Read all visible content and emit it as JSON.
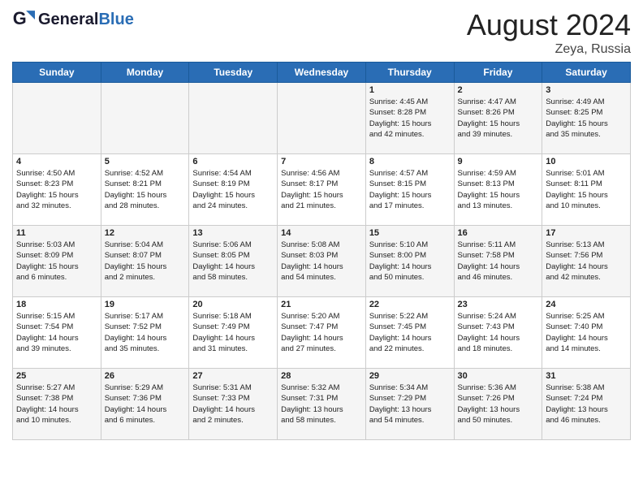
{
  "header": {
    "logo_line1": "General",
    "logo_line2": "Blue",
    "month": "August 2024",
    "location": "Zeya, Russia"
  },
  "days_of_week": [
    "Sunday",
    "Monday",
    "Tuesday",
    "Wednesday",
    "Thursday",
    "Friday",
    "Saturday"
  ],
  "weeks": [
    [
      {
        "day": "",
        "info": ""
      },
      {
        "day": "",
        "info": ""
      },
      {
        "day": "",
        "info": ""
      },
      {
        "day": "",
        "info": ""
      },
      {
        "day": "1",
        "info": "Sunrise: 4:45 AM\nSunset: 8:28 PM\nDaylight: 15 hours\nand 42 minutes."
      },
      {
        "day": "2",
        "info": "Sunrise: 4:47 AM\nSunset: 8:26 PM\nDaylight: 15 hours\nand 39 minutes."
      },
      {
        "day": "3",
        "info": "Sunrise: 4:49 AM\nSunset: 8:25 PM\nDaylight: 15 hours\nand 35 minutes."
      }
    ],
    [
      {
        "day": "4",
        "info": "Sunrise: 4:50 AM\nSunset: 8:23 PM\nDaylight: 15 hours\nand 32 minutes."
      },
      {
        "day": "5",
        "info": "Sunrise: 4:52 AM\nSunset: 8:21 PM\nDaylight: 15 hours\nand 28 minutes."
      },
      {
        "day": "6",
        "info": "Sunrise: 4:54 AM\nSunset: 8:19 PM\nDaylight: 15 hours\nand 24 minutes."
      },
      {
        "day": "7",
        "info": "Sunrise: 4:56 AM\nSunset: 8:17 PM\nDaylight: 15 hours\nand 21 minutes."
      },
      {
        "day": "8",
        "info": "Sunrise: 4:57 AM\nSunset: 8:15 PM\nDaylight: 15 hours\nand 17 minutes."
      },
      {
        "day": "9",
        "info": "Sunrise: 4:59 AM\nSunset: 8:13 PM\nDaylight: 15 hours\nand 13 minutes."
      },
      {
        "day": "10",
        "info": "Sunrise: 5:01 AM\nSunset: 8:11 PM\nDaylight: 15 hours\nand 10 minutes."
      }
    ],
    [
      {
        "day": "11",
        "info": "Sunrise: 5:03 AM\nSunset: 8:09 PM\nDaylight: 15 hours\nand 6 minutes."
      },
      {
        "day": "12",
        "info": "Sunrise: 5:04 AM\nSunset: 8:07 PM\nDaylight: 15 hours\nand 2 minutes."
      },
      {
        "day": "13",
        "info": "Sunrise: 5:06 AM\nSunset: 8:05 PM\nDaylight: 14 hours\nand 58 minutes."
      },
      {
        "day": "14",
        "info": "Sunrise: 5:08 AM\nSunset: 8:03 PM\nDaylight: 14 hours\nand 54 minutes."
      },
      {
        "day": "15",
        "info": "Sunrise: 5:10 AM\nSunset: 8:00 PM\nDaylight: 14 hours\nand 50 minutes."
      },
      {
        "day": "16",
        "info": "Sunrise: 5:11 AM\nSunset: 7:58 PM\nDaylight: 14 hours\nand 46 minutes."
      },
      {
        "day": "17",
        "info": "Sunrise: 5:13 AM\nSunset: 7:56 PM\nDaylight: 14 hours\nand 42 minutes."
      }
    ],
    [
      {
        "day": "18",
        "info": "Sunrise: 5:15 AM\nSunset: 7:54 PM\nDaylight: 14 hours\nand 39 minutes."
      },
      {
        "day": "19",
        "info": "Sunrise: 5:17 AM\nSunset: 7:52 PM\nDaylight: 14 hours\nand 35 minutes."
      },
      {
        "day": "20",
        "info": "Sunrise: 5:18 AM\nSunset: 7:49 PM\nDaylight: 14 hours\nand 31 minutes."
      },
      {
        "day": "21",
        "info": "Sunrise: 5:20 AM\nSunset: 7:47 PM\nDaylight: 14 hours\nand 27 minutes."
      },
      {
        "day": "22",
        "info": "Sunrise: 5:22 AM\nSunset: 7:45 PM\nDaylight: 14 hours\nand 22 minutes."
      },
      {
        "day": "23",
        "info": "Sunrise: 5:24 AM\nSunset: 7:43 PM\nDaylight: 14 hours\nand 18 minutes."
      },
      {
        "day": "24",
        "info": "Sunrise: 5:25 AM\nSunset: 7:40 PM\nDaylight: 14 hours\nand 14 minutes."
      }
    ],
    [
      {
        "day": "25",
        "info": "Sunrise: 5:27 AM\nSunset: 7:38 PM\nDaylight: 14 hours\nand 10 minutes."
      },
      {
        "day": "26",
        "info": "Sunrise: 5:29 AM\nSunset: 7:36 PM\nDaylight: 14 hours\nand 6 minutes."
      },
      {
        "day": "27",
        "info": "Sunrise: 5:31 AM\nSunset: 7:33 PM\nDaylight: 14 hours\nand 2 minutes."
      },
      {
        "day": "28",
        "info": "Sunrise: 5:32 AM\nSunset: 7:31 PM\nDaylight: 13 hours\nand 58 minutes."
      },
      {
        "day": "29",
        "info": "Sunrise: 5:34 AM\nSunset: 7:29 PM\nDaylight: 13 hours\nand 54 minutes."
      },
      {
        "day": "30",
        "info": "Sunrise: 5:36 AM\nSunset: 7:26 PM\nDaylight: 13 hours\nand 50 minutes."
      },
      {
        "day": "31",
        "info": "Sunrise: 5:38 AM\nSunset: 7:24 PM\nDaylight: 13 hours\nand 46 minutes."
      }
    ]
  ]
}
